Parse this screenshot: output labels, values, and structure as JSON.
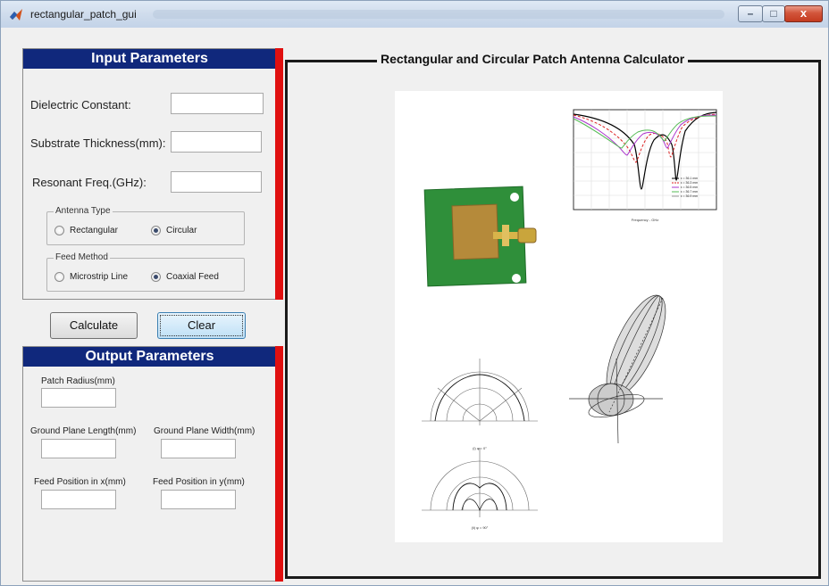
{
  "window": {
    "title": "rectangular_patch_gui",
    "minimize_glyph": "–",
    "maximize_glyph": "□",
    "close_glyph": "x"
  },
  "input_panel": {
    "header": "Input Parameters",
    "dielectric_label": "Dielectric Constant:",
    "dielectric_value": "",
    "thickness_label": "Substrate Thickness(mm):",
    "thickness_value": "",
    "freq_label": "Resonant Freq.(GHz):",
    "freq_value": "",
    "antenna_type": {
      "title": "Antenna Type",
      "options": [
        "Rectangular",
        "Circular"
      ],
      "selected": "Circular"
    },
    "feed_method": {
      "title": "Feed Method",
      "options": [
        "Microstrip Line",
        "Coaxial Feed"
      ],
      "selected": "Coaxial Feed"
    }
  },
  "buttons": {
    "calculate": "Calculate",
    "clear": "Clear"
  },
  "output_panel": {
    "header": "Output Parameters",
    "patch_radius_label": "Patch Radius(mm)",
    "ground_length_label": "Ground Plane Length(mm)",
    "ground_width_label": "Ground Plane Width(mm)",
    "feed_x_label": "Feed Position in x(mm)",
    "feed_y_label": "Feed Position in y(mm)"
  },
  "main": {
    "title": "Rectangular and Circular Patch Antenna Calculator",
    "s11_legend": [
      "ε = 36.1 mm",
      "ε = 36.3 mm",
      "ε = 36.5 mm",
      "ε = 36.7 mm",
      "ε = 36.9 mm"
    ],
    "s11_xlabel": "Frequency - GHz",
    "polar_top_caption": "(i) φ = 0°",
    "polar_bottom_caption": "(ii) φ = 90°"
  },
  "colors": {
    "header_blue": "#10287c",
    "red_bar": "#e01010",
    "pcb_green": "#2f8f3a",
    "patch_gold": "#b58a3a"
  }
}
